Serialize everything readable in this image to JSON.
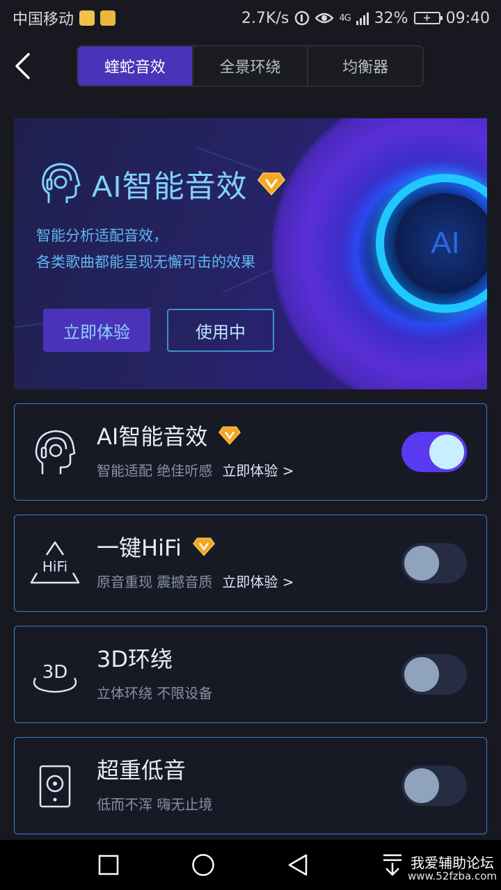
{
  "status_bar": {
    "carrier": "中国移动",
    "speed": "2.7K/s",
    "network_type": "4G",
    "battery": "32%",
    "time": "09:40"
  },
  "tabs": [
    {
      "label": "蝰蛇音效",
      "active": true
    },
    {
      "label": "全景环绕",
      "active": false
    },
    {
      "label": "均衡器",
      "active": false
    }
  ],
  "hero": {
    "title": "AI智能音效",
    "desc_line1": "智能分析适配音效，",
    "desc_line2": "各类歌曲都能呈现无懈可击的效果",
    "orb_text": "AI",
    "btn_try": "立即体验",
    "btn_status": "使用中"
  },
  "features": [
    {
      "title": "AI智能音效",
      "subtitle": "智能适配 绝佳听感",
      "link": "立即体验 >",
      "vip": true,
      "enabled": true,
      "icon": "headphone-head-icon"
    },
    {
      "title": "一键HiFi",
      "subtitle": "原音重现 震撼音质",
      "link": "立即体验 >",
      "vip": true,
      "enabled": false,
      "icon": "hifi-icon"
    },
    {
      "title": "3D环绕",
      "subtitle": "立体环绕 不限设备",
      "link": "",
      "vip": false,
      "enabled": false,
      "icon": "3d-surround-icon"
    },
    {
      "title": "超重低音",
      "subtitle": "低而不浑 嗨无止境",
      "link": "",
      "vip": false,
      "enabled": false,
      "icon": "speaker-icon"
    }
  ],
  "icon_labels": {
    "hifi": "HiFi",
    "three_d": "3D"
  },
  "watermark": {
    "main": "我爱辅助论坛",
    "url": "www.52fzba.com"
  },
  "colors": {
    "accent": "#4a33b8",
    "toggle_on": "#5a3af0",
    "card_border": "#3a7ec4",
    "vip_gold": "#f5a623"
  }
}
